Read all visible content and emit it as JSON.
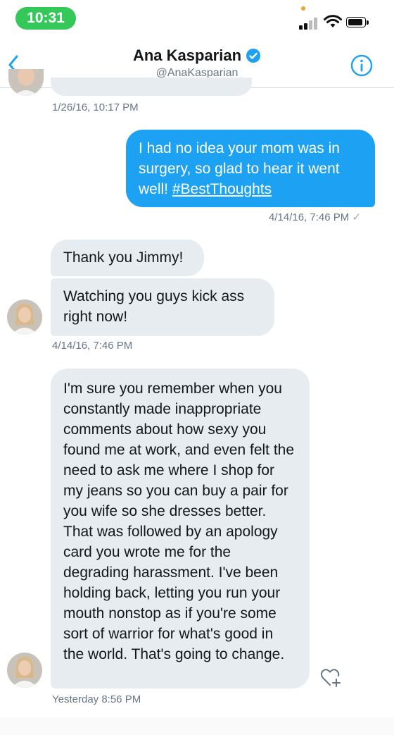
{
  "status_bar": {
    "time": "10:31"
  },
  "header": {
    "name": "Ana Kasparian",
    "handle": "@AnaKasparian",
    "verified": true,
    "back_icon": "chevron-left-icon",
    "info_icon": "info-icon"
  },
  "messages": [
    {
      "from": "them",
      "text": ""
    },
    {
      "timestamp": "1/26/16, 10:17 PM"
    },
    {
      "from": "me",
      "text": "I had no idea your mom was in surgery, so glad to hear it went well!",
      "hashtag": "#BestThoughts"
    },
    {
      "timestamp": "4/14/16, 7:46 PM",
      "receipt": "✓"
    },
    {
      "from": "them",
      "text": "Thank you Jimmy!"
    },
    {
      "from": "them",
      "text": "Watching you guys kick ass right now!"
    },
    {
      "timestamp": "4/14/16, 7:46 PM"
    },
    {
      "from": "them",
      "text": "I'm sure you remember when you constantly made inappropriate comments about how sexy you found me at work, and even felt the need to ask me where I shop for my jeans so you can buy a pair for you wife so she dresses better. That was followed by an apology card you wrote me for the degrading harassment. I've been holding back, letting you run your mouth nonstop as if you're some sort of warrior for what's good in the world. That's going to change."
    },
    {
      "timestamp": "Yesterday 8:56 PM"
    }
  ],
  "colors": {
    "accent": "#1da1f2",
    "them_bubble": "#e6ecf0",
    "timestamp": "#657786",
    "status_pill": "#34c759"
  }
}
